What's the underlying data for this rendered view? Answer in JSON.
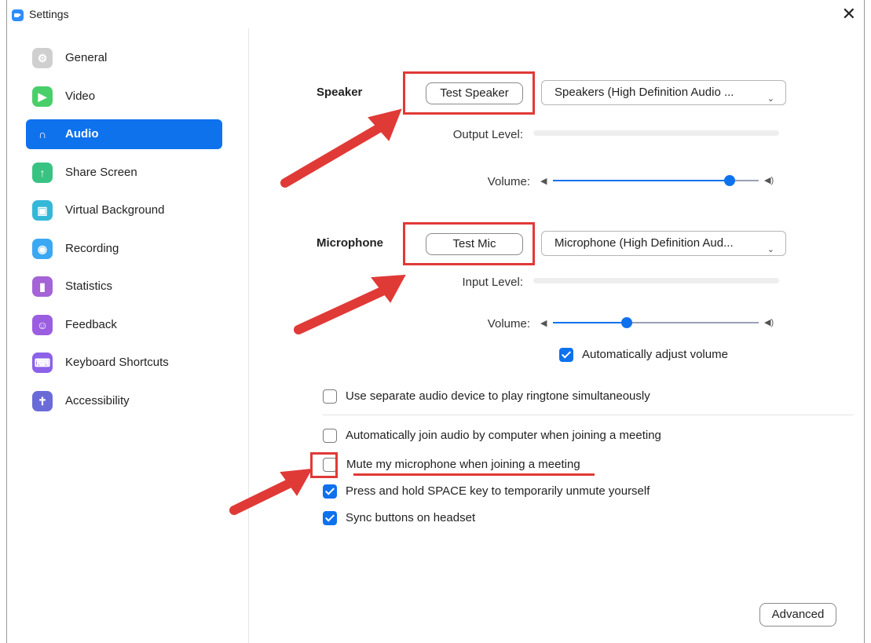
{
  "window": {
    "title": "Settings",
    "close_glyph": "✕"
  },
  "sidebar": {
    "items": [
      {
        "label": "General",
        "icon": "gear-icon",
        "color": "#cfcfcf",
        "glyph": "⚙",
        "active": false
      },
      {
        "label": "Video",
        "icon": "video-icon",
        "color": "#48cf6a",
        "glyph": "▶",
        "active": false
      },
      {
        "label": "Audio",
        "icon": "headphones-icon",
        "color": "#0e72ed",
        "glyph": "∩",
        "active": true
      },
      {
        "label": "Share Screen",
        "icon": "share-screen-icon",
        "color": "#39c383",
        "glyph": "↑",
        "active": false
      },
      {
        "label": "Virtual Background",
        "icon": "virtual-background-icon",
        "color": "#35b8d8",
        "glyph": "▣",
        "active": false
      },
      {
        "label": "Recording",
        "icon": "recording-icon",
        "color": "#3ba8f3",
        "glyph": "◉",
        "active": false
      },
      {
        "label": "Statistics",
        "icon": "statistics-icon",
        "color": "#a463d6",
        "glyph": "▮",
        "active": false
      },
      {
        "label": "Feedback",
        "icon": "feedback-icon",
        "color": "#9b5ee0",
        "glyph": "☺",
        "active": false
      },
      {
        "label": "Keyboard Shortcuts",
        "icon": "keyboard-icon",
        "color": "#8c62e8",
        "glyph": "⌨",
        "active": false
      },
      {
        "label": "Accessibility",
        "icon": "accessibility-icon",
        "color": "#6a6bd8",
        "glyph": "✝",
        "active": false
      }
    ]
  },
  "speaker": {
    "label": "Speaker",
    "test_button": "Test Speaker",
    "device": "Speakers (High Definition Audio ...",
    "output_level_label": "Output Level:",
    "volume_label": "Volume:",
    "volume_level": 0.86
  },
  "microphone": {
    "label": "Microphone",
    "test_button": "Test Mic",
    "device": "Microphone (High Definition Aud...",
    "input_level_label": "Input Level:",
    "volume_label": "Volume:",
    "volume_level": 0.36,
    "auto_adjust": {
      "label": "Automatically adjust volume",
      "checked": true
    }
  },
  "options": {
    "separate_device": {
      "label": "Use separate audio device to play ringtone simultaneously",
      "checked": false
    },
    "auto_join": {
      "label": "Automatically join audio by computer when joining a meeting",
      "checked": false
    },
    "mute_on_join": {
      "label": "Mute my microphone when joining a meeting",
      "checked": false
    },
    "space_unmute": {
      "label": "Press and hold SPACE key to temporarily unmute yourself",
      "checked": true
    },
    "sync_headset": {
      "label": "Sync buttons on headset",
      "checked": true
    }
  },
  "advanced_button": "Advanced",
  "colors": {
    "accent": "#0e72ed",
    "annotation": "#e03a37"
  }
}
